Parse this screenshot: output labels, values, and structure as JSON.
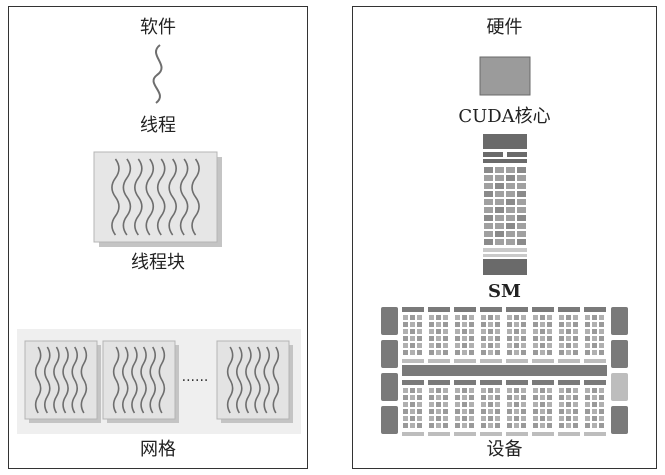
{
  "software": {
    "title": "软件",
    "thread_label": "线程",
    "block_label": "线程块",
    "grid_label": "网格",
    "grid_ellipsis": "······"
  },
  "hardware": {
    "title": "硬件",
    "core_label": "CUDA核心",
    "sm_label": "SM",
    "device_label": "设备"
  },
  "colors": {
    "border": "#333333",
    "block_fill": "#e6e6e6",
    "block_shadow": "#c4c4c4",
    "grid_bg": "#efefef",
    "wave": "#6e6e6e",
    "core": "#9b9b9b",
    "sm_dark": "#6a6a6a",
    "sm_light": "#c9c9c9",
    "device_dark": "#7a7a7a",
    "device_light": "#bdbdbd"
  }
}
